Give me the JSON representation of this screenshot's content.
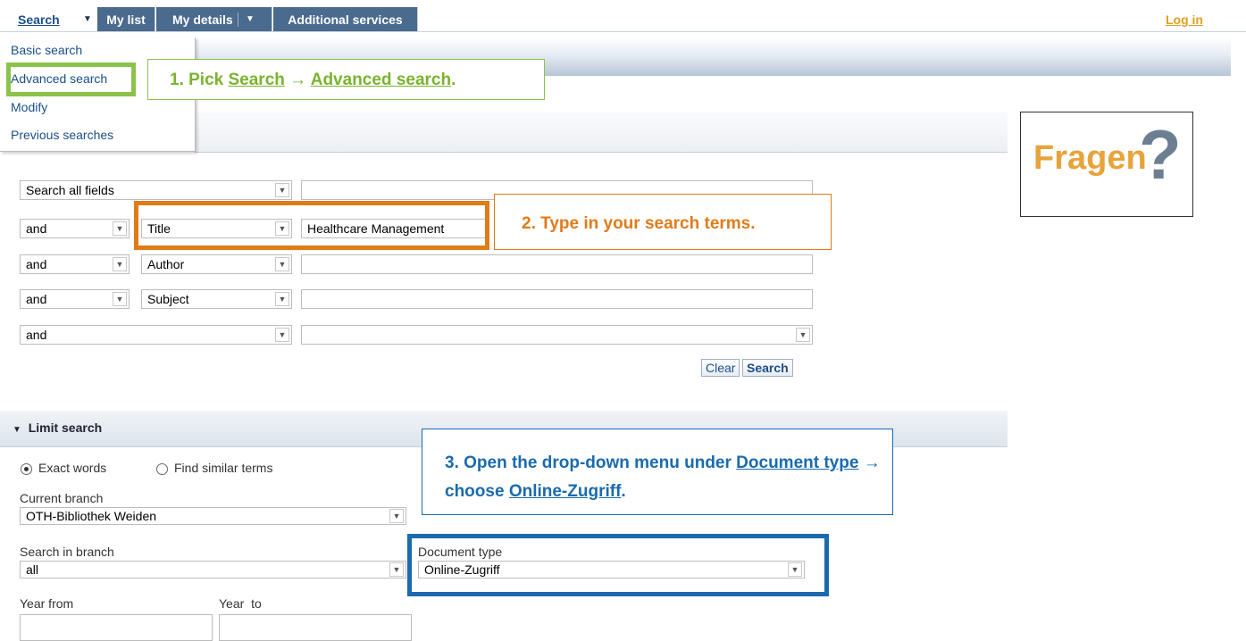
{
  "nav": {
    "tabs": [
      "Search",
      "My list",
      "My details",
      "Additional services"
    ],
    "login": "Log in"
  },
  "menu": {
    "items": [
      "Basic search",
      "Advanced search",
      "Modify",
      "Previous searches"
    ]
  },
  "callouts": {
    "c1_prefix": "1. Pick ",
    "c1_link1": "Search",
    "c1_arrow": " → ",
    "c1_link2": "Advanced search",
    "c1_suffix": ".",
    "c2": "2. Type in your search terms.",
    "c3_prefix": "3. Open the drop-down menu under ",
    "c3_link1": "Document type",
    "c3_arrow": " → ",
    "c3_line2_prefix": "choose ",
    "c3_link2": "Online-Zugriff",
    "c3_suffix": "."
  },
  "fragen": {
    "text": "Fragen",
    "mark": "?"
  },
  "search_rows": [
    {
      "operator": "",
      "field": "Search all fields",
      "value": ""
    },
    {
      "operator": "and",
      "field": "Title",
      "value": "Healthcare Management"
    },
    {
      "operator": "and",
      "field": "Author",
      "value": ""
    },
    {
      "operator": "and",
      "field": "Subject",
      "value": ""
    },
    {
      "operator": "and",
      "field": "",
      "value": ""
    }
  ],
  "buttons": {
    "clear": "Clear",
    "search": "Search"
  },
  "limit": {
    "title": "Limit search",
    "exact_words": "Exact words",
    "find_similar": "Find similar terms",
    "current_branch_label": "Current branch",
    "current_branch_value": "OTH-Bibliothek Weiden",
    "search_in_branch_label": "Search in branch",
    "search_in_branch_value": "all",
    "document_type_label": "Document type",
    "document_type_value": "Online-Zugriff",
    "year_from_label": "Year from",
    "year_to_label": "Year  to"
  },
  "colors": {
    "nav_blue": "#4a6a8e",
    "green": "#8bc34a",
    "orange": "#e07b1a",
    "blue": "#1a6aae",
    "login": "#e0a020"
  }
}
